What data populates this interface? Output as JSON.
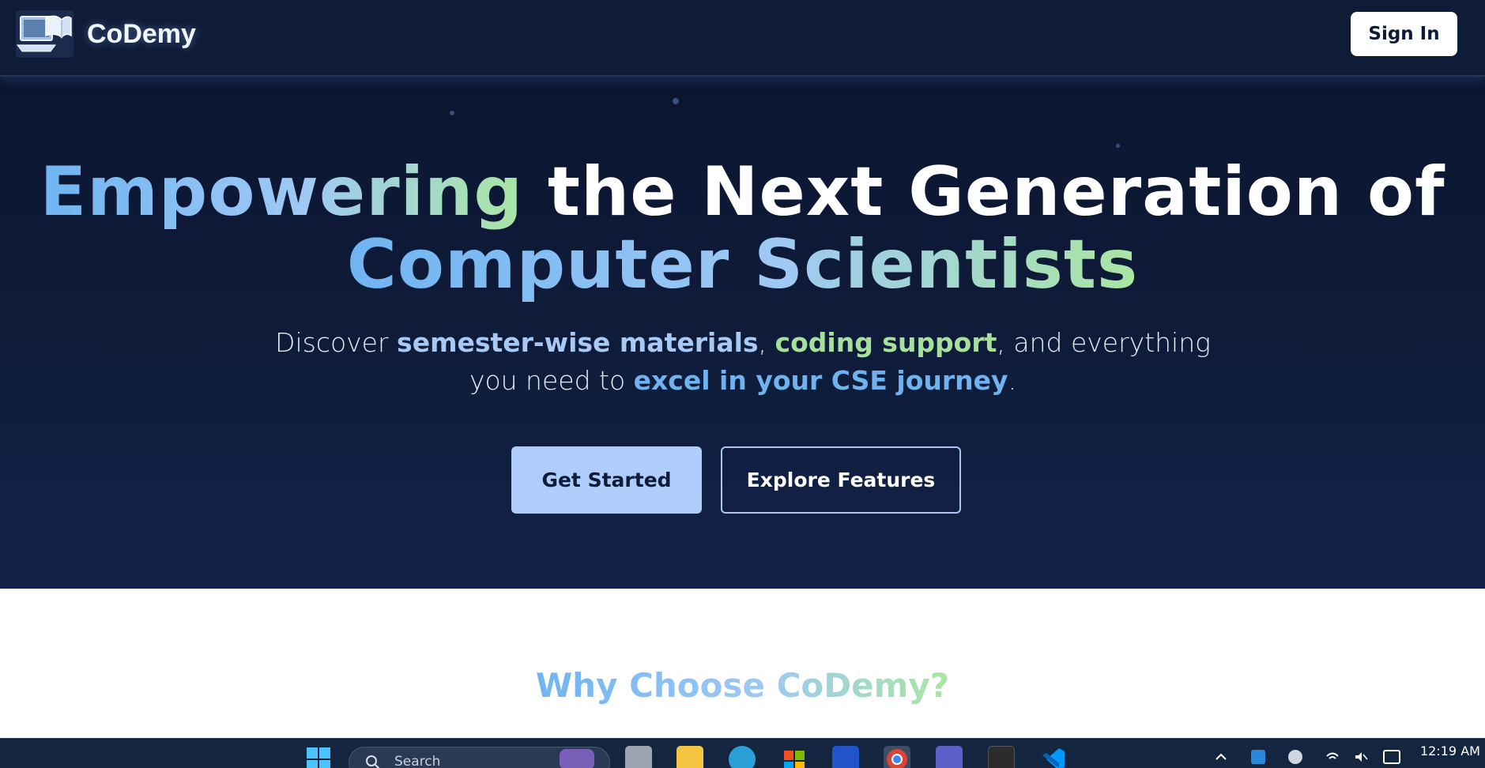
{
  "header": {
    "brand": "CoDemy",
    "sign_in": "Sign In",
    "logo_icon": "laptop-book-icon"
  },
  "hero": {
    "title_part1": "Empowering",
    "title_part2": " the Next Generation of",
    "title_part3": "Computer Scientists",
    "subtitle": {
      "p1": "Discover ",
      "h1": "semester-wise materials",
      "p2": ", ",
      "h2": "coding support",
      "p3": ", and everything you need to ",
      "h3": "excel in your CSE journey",
      "p4": "."
    },
    "primary_cta": "Get Started",
    "secondary_cta": "Explore Features"
  },
  "section": {
    "title": "Why Choose CoDemy?"
  },
  "taskbar": {
    "search_placeholder": "Search",
    "time": "12:19 AM",
    "apps": [
      "windows-start-icon",
      "file-icon",
      "file-explorer-icon",
      "edge-icon",
      "store-icon",
      "app-icon",
      "chrome-icon",
      "teams-icon",
      "terminal-icon",
      "vscode-icon"
    ]
  },
  "colors": {
    "hero_bg": "#0f1d3c",
    "accent_blue": "#6fb2ee",
    "accent_green": "#a6e09c",
    "button_primary": "#aecdfa"
  }
}
